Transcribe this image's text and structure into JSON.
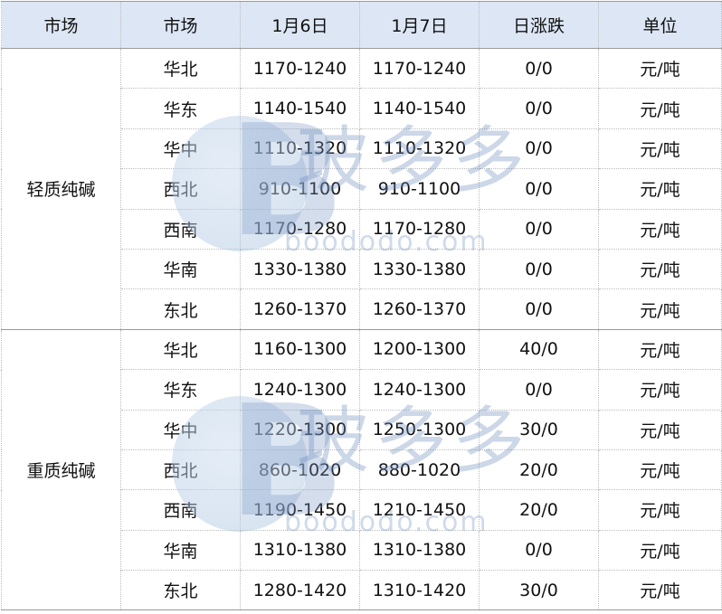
{
  "table": {
    "headers": [
      "市场",
      "市场",
      "1月6日",
      "1月7日",
      "日涨跌",
      "单位"
    ],
    "groups": [
      {
        "name": "轻质纯碱",
        "rows": [
          [
            "华北",
            "1170-1240",
            "1170-1240",
            "0/0",
            "元/吨"
          ],
          [
            "华东",
            "1140-1540",
            "1140-1540",
            "0/0",
            "元/吨"
          ],
          [
            "华中",
            "1110-1320",
            "1110-1320",
            "0/0",
            "元/吨"
          ],
          [
            "西北",
            "910-1100",
            "910-1100",
            "0/0",
            "元/吨"
          ],
          [
            "西南",
            "1170-1280",
            "1170-1280",
            "0/0",
            "元/吨"
          ],
          [
            "华南",
            "1330-1380",
            "1330-1380",
            "0/0",
            "元/吨"
          ],
          [
            "东北",
            "1260-1370",
            "1260-1370",
            "0/0",
            "元/吨"
          ]
        ]
      },
      {
        "name": "重质纯碱",
        "rows": [
          [
            "华北",
            "1160-1300",
            "1200-1300",
            "40/0",
            "元/吨"
          ],
          [
            "华东",
            "1240-1300",
            "1240-1300",
            "0/0",
            "元/吨"
          ],
          [
            "华中",
            "1220-1300",
            "1250-1300",
            "30/0",
            "元/吨"
          ],
          [
            "西北",
            "860-1020",
            "880-1020",
            "20/0",
            "元/吨"
          ],
          [
            "西南",
            "1190-1450",
            "1210-1450",
            "20/0",
            "元/吨"
          ],
          [
            "华南",
            "1310-1380",
            "1310-1380",
            "0/0",
            "元/吨"
          ],
          [
            "东北",
            "1280-1420",
            "1310-1420",
            "30/0",
            "元/吨"
          ]
        ]
      }
    ]
  },
  "watermark": {
    "logo_letter": "B",
    "chinese": "玻多多",
    "english": "boododo.com"
  }
}
